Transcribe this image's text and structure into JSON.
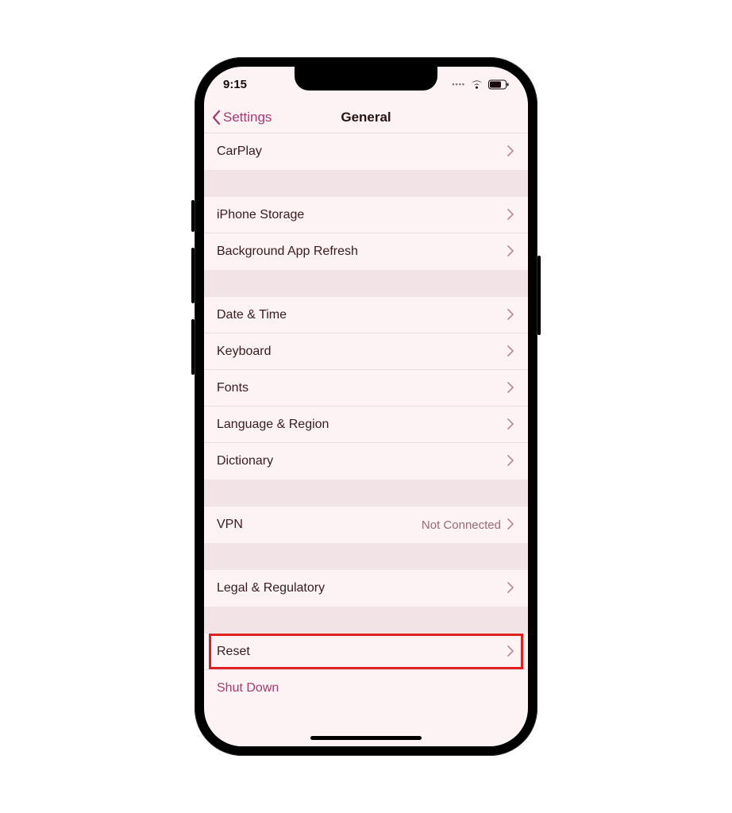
{
  "status": {
    "time": "9:15"
  },
  "nav": {
    "back": "Settings",
    "title": "General"
  },
  "rows": {
    "carplay": "CarPlay",
    "storage": "iPhone Storage",
    "bgrefresh": "Background App Refresh",
    "datetime": "Date & Time",
    "keyboard": "Keyboard",
    "fonts": "Fonts",
    "language": "Language & Region",
    "dictionary": "Dictionary",
    "vpn": "VPN",
    "vpn_value": "Not Connected",
    "legal": "Legal & Regulatory",
    "reset": "Reset",
    "shutdown": "Shut Down"
  }
}
